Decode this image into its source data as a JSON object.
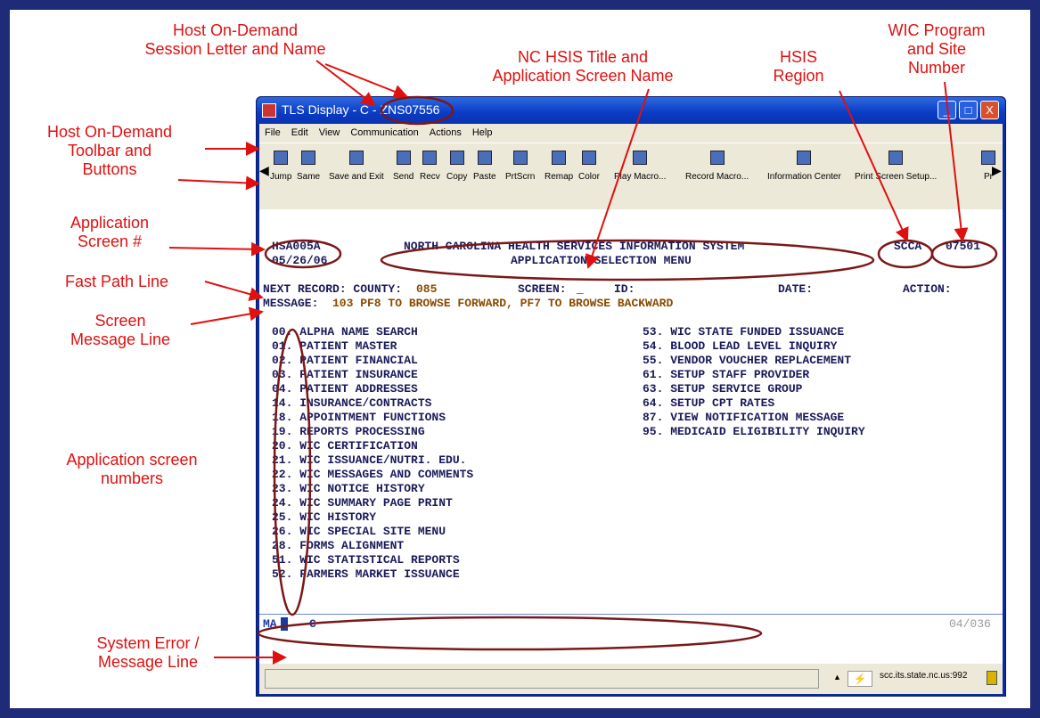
{
  "annotations": {
    "session": "Host On-Demand\nSession Letter and Name",
    "title": "NC HSIS Title and\nApplication Screen Name",
    "region": "HSIS\nRegion",
    "site": "WIC Program\nand Site\nNumber",
    "toolbar": "Host On-Demand\nToolbar and\nButtons",
    "appscreen": "Application\nScreen #",
    "fastpath": "Fast Path Line",
    "screenmsg": "Screen\nMessage Line",
    "appnums": "Application screen\nnumbers",
    "syserr": "System Error /\nMessage Line"
  },
  "window": {
    "title": "TLS Display - C - ZNS07556",
    "buttons": {
      "min": "_",
      "max": "□",
      "close": "X"
    }
  },
  "menu": [
    "File",
    "Edit",
    "View",
    "Communication",
    "Actions",
    "Help"
  ],
  "toolbar": [
    "Jump",
    "Same",
    "Save and Exit",
    "Send",
    "Recv",
    "Copy",
    "Paste",
    "PrtScrn",
    "Remap",
    "Color",
    "Play Macro...",
    "Record Macro...",
    "Information Center",
    "Print Screen Setup...",
    "Pr"
  ],
  "screen": {
    "screen_id": "HSA005A",
    "date": "05/26/06",
    "system_title": "NORTH CAROLINA HEALTH SERVICES INFORMATION SYSTEM",
    "menu_title": "APPLICATION SELECTION MENU",
    "region": "SCCA",
    "site": "07501",
    "next_record_label": "NEXT RECORD: COUNTY:",
    "county": "085",
    "screen_label": "SCREEN:",
    "screen_value": "_",
    "id_label": "ID:",
    "date_label": "DATE:",
    "action_label": "ACTION:",
    "message_label": "MESSAGE:",
    "message_text": "103 PF8 TO BROWSE FORWARD, PF7 TO BROWSE BACKWARD",
    "left_menu": [
      "00. ALPHA NAME SEARCH",
      "01. PATIENT MASTER",
      "02. PATIENT FINANCIAL",
      "03. PATIENT INSURANCE",
      "04. PATIENT ADDRESSES",
      "14. INSURANCE/CONTRACTS",
      "18. APPOINTMENT FUNCTIONS",
      "19. REPORTS PROCESSING",
      "20. WIC CERTIFICATION",
      "21. WIC ISSUANCE/NUTRI. EDU.",
      "22. WIC MESSAGES AND COMMENTS",
      "23. WIC NOTICE HISTORY",
      "24. WIC SUMMARY PAGE PRINT",
      "25. WIC HISTORY",
      "26. WIC SPECIAL SITE MENU",
      "28. FORMS ALIGNMENT",
      "51. WIC STATISTICAL REPORTS",
      "52. FARMERS MARKET ISSUANCE"
    ],
    "right_menu": [
      "53. WIC STATE FUNDED ISSUANCE",
      "54. BLOOD LEAD LEVEL INQUIRY",
      "55. VENDOR VOUCHER REPLACEMENT",
      "61. SETUP STAFF PROVIDER",
      "63. SETUP SERVICE GROUP",
      "64. SETUP CPT RATES",
      "87. VIEW NOTIFICATION MESSAGE",
      "95. MEDICAID ELIGIBILITY INQUIRY"
    ],
    "oia_left": "MA",
    "oia_c": "C",
    "oia_right": "04/036"
  },
  "status": {
    "host": "scc.its.state.nc.us:992"
  },
  "colors": {
    "annotation": "#e01010",
    "oval": "#8a1a1a",
    "screen_text": "#1a1a5a"
  }
}
